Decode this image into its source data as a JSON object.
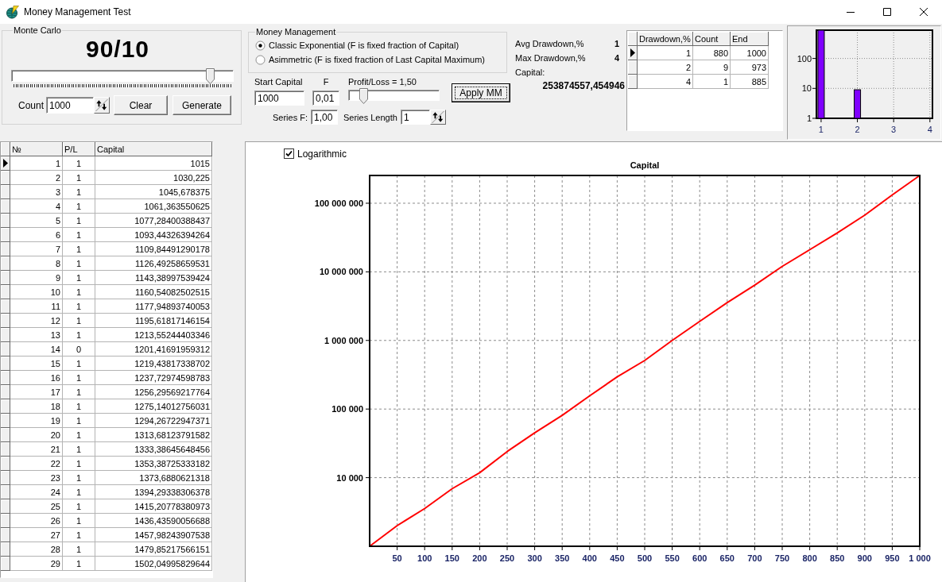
{
  "window": {
    "title": "Money Management Test"
  },
  "monte_carlo": {
    "title": "Monte Carlo",
    "ratio": "90/10",
    "slider": {
      "level": 0.9
    },
    "count": {
      "label": "Count",
      "value": "1000"
    },
    "clear_button": "Clear",
    "generate_button": "Generate"
  },
  "money_management": {
    "title": "Money Management",
    "options": [
      {
        "label": "Classic Exponential (F is fixed fraction of Capital)",
        "selected": true
      },
      {
        "label": "Asimmetric (F is fixed fraction of Last Capital Maximum)",
        "selected": false
      }
    ],
    "start_capital": {
      "label": "Start Capital",
      "value": "1000"
    },
    "f": {
      "label": "F",
      "value": "0,01"
    },
    "profit_loss": {
      "label": "Profit/Loss = 1,50",
      "level": 0.17
    },
    "apply_button": "Apply MM",
    "series_f": {
      "label": "Series F:",
      "value": "1,00"
    },
    "series_length": {
      "label": "Series Length",
      "value": "1"
    }
  },
  "drawdown_stats": [
    {
      "label": "Avg Drawdown,%",
      "value": "1"
    },
    {
      "label": "Max Drawdown,%",
      "value": "4"
    }
  ],
  "capital": {
    "label": "Capital:",
    "value": "253874557,454946"
  },
  "drawdown_table": {
    "columns": [
      "Drawdown,%",
      "Count",
      "End"
    ],
    "rows": [
      {
        "cells": [
          "1",
          "880",
          "1000"
        ],
        "selected": true
      },
      {
        "cells": [
          "2",
          "9",
          "973"
        ],
        "selected": false
      },
      {
        "cells": [
          "4",
          "1",
          "885"
        ],
        "selected": false
      }
    ]
  },
  "drawdown_histogram": {
    "chart_data": {
      "type": "bar",
      "x": [
        1,
        2
      ],
      "values": [
        880,
        9
      ],
      "color": "#8000ff",
      "log": true,
      "xlim": [
        0.87,
        4.07
      ],
      "ylim": [
        1,
        880
      ],
      "xticks": [
        1,
        2,
        3,
        4
      ],
      "yticks": [
        1,
        10,
        100
      ],
      "grid": true
    }
  },
  "trades_table": {
    "columns": [
      "№",
      "P/L",
      "Capital"
    ],
    "rows": [
      {
        "cells": [
          "1",
          "1",
          "1015"
        ],
        "selected": true
      },
      {
        "cells": [
          "2",
          "1",
          "1030,225"
        ],
        "selected": false
      },
      {
        "cells": [
          "3",
          "1",
          "1045,678375"
        ],
        "selected": false
      },
      {
        "cells": [
          "4",
          "1",
          "1061,363550625"
        ],
        "selected": false
      },
      {
        "cells": [
          "5",
          "1",
          "1077,28400388437"
        ],
        "selected": false
      },
      {
        "cells": [
          "6",
          "1",
          "1093,44326394264"
        ],
        "selected": false
      },
      {
        "cells": [
          "7",
          "1",
          "1109,84491290178"
        ],
        "selected": false
      },
      {
        "cells": [
          "8",
          "1",
          "1126,49258659531"
        ],
        "selected": false
      },
      {
        "cells": [
          "9",
          "1",
          "1143,38997539424"
        ],
        "selected": false
      },
      {
        "cells": [
          "10",
          "1",
          "1160,54082502515"
        ],
        "selected": false
      },
      {
        "cells": [
          "11",
          "1",
          "1177,94893740053"
        ],
        "selected": false
      },
      {
        "cells": [
          "12",
          "1",
          "1195,61817146154"
        ],
        "selected": false
      },
      {
        "cells": [
          "13",
          "1",
          "1213,55244403346"
        ],
        "selected": false
      },
      {
        "cells": [
          "14",
          "0",
          "1201,41691959312"
        ],
        "selected": false
      },
      {
        "cells": [
          "15",
          "1",
          "1219,43817338702"
        ],
        "selected": false
      },
      {
        "cells": [
          "16",
          "1",
          "1237,72974598783"
        ],
        "selected": false
      },
      {
        "cells": [
          "17",
          "1",
          "1256,29569217764"
        ],
        "selected": false
      },
      {
        "cells": [
          "18",
          "1",
          "1275,14012756031"
        ],
        "selected": false
      },
      {
        "cells": [
          "19",
          "1",
          "1294,26722947371"
        ],
        "selected": false
      },
      {
        "cells": [
          "20",
          "1",
          "1313,68123791582"
        ],
        "selected": false
      },
      {
        "cells": [
          "21",
          "1",
          "1333,38645648456"
        ],
        "selected": false
      },
      {
        "cells": [
          "22",
          "1",
          "1353,38725333182"
        ],
        "selected": false
      },
      {
        "cells": [
          "23",
          "1",
          "1373,6880621318"
        ],
        "selected": false
      },
      {
        "cells": [
          "24",
          "1",
          "1394,29338306378"
        ],
        "selected": false
      },
      {
        "cells": [
          "25",
          "1",
          "1415,20778380973"
        ],
        "selected": false
      },
      {
        "cells": [
          "26",
          "1",
          "1436,43590056688"
        ],
        "selected": false
      },
      {
        "cells": [
          "27",
          "1",
          "1457,98243907538"
        ],
        "selected": false
      },
      {
        "cells": [
          "28",
          "1",
          "1479,85217566151"
        ],
        "selected": false
      },
      {
        "cells": [
          "29",
          "1",
          "1502,04995829644"
        ],
        "selected": false
      }
    ]
  },
  "capital_chart": {
    "logarithmic": {
      "label": "Logarithmic",
      "checked": true
    },
    "chart_data": {
      "type": "line",
      "title": "Capital",
      "x": [
        0,
        50,
        100,
        150,
        200,
        250,
        300,
        350,
        400,
        450,
        500,
        550,
        600,
        650,
        700,
        750,
        800,
        850,
        900,
        950,
        1000
      ],
      "values": [
        1000,
        2000,
        3550,
        6900,
        11800,
        24000,
        45000,
        81000,
        156000,
        295000,
        510000,
        1000000,
        1900000,
        3550000,
        6400000,
        12000000,
        21000000,
        37000000,
        67000000,
        132000000,
        253874557
      ],
      "color": "#ff0000",
      "log": true,
      "xlim": [
        0,
        1000
      ],
      "ylim": [
        1000,
        253874557
      ],
      "xticks": [
        50,
        100,
        150,
        200,
        250,
        300,
        350,
        400,
        450,
        500,
        550,
        600,
        650,
        700,
        750,
        800,
        850,
        900,
        950,
        {
          "value": 1000,
          "label": "1 000"
        }
      ],
      "yticks": [
        {
          "value": 10000,
          "label": "10 000"
        },
        {
          "value": 100000,
          "label": "100 000"
        },
        {
          "value": 1000000,
          "label": "1 000 000"
        },
        {
          "value": 10000000,
          "label": "10 000 000"
        },
        {
          "value": 100000000,
          "label": "100 000 000"
        }
      ],
      "grid": true
    }
  }
}
